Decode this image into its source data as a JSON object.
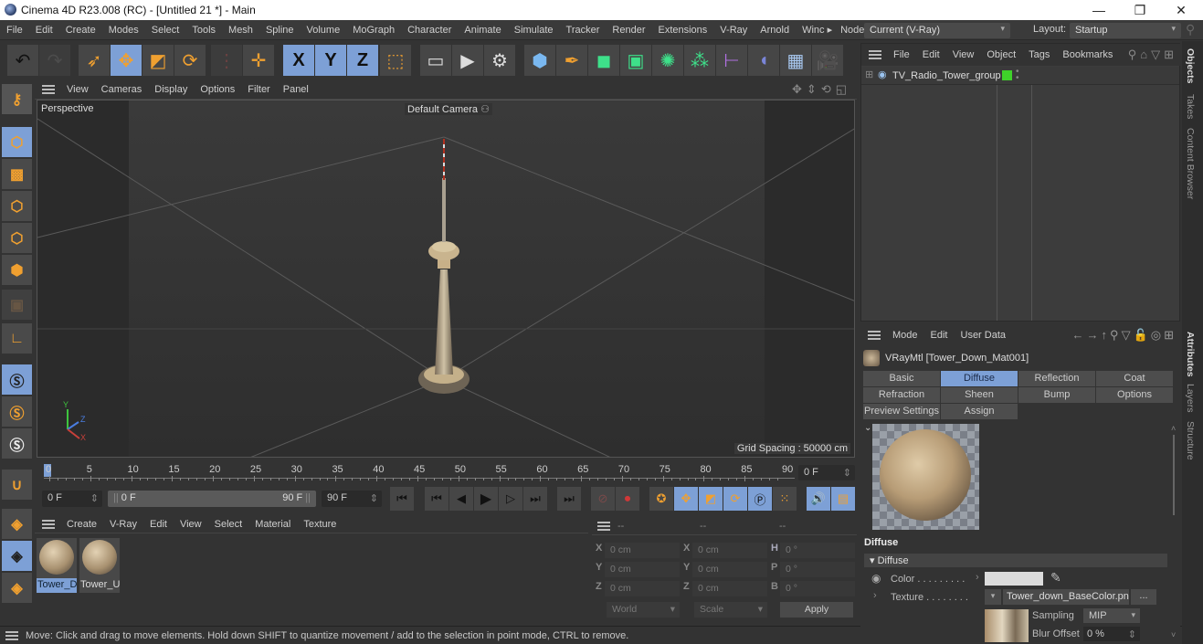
{
  "window": {
    "title": "Cinema 4D R23.008 (RC) - [Untitled 21 *] - Main",
    "minimize_glyph": "—",
    "maximize_glyph": "❐",
    "close_glyph": "✕"
  },
  "menubar": {
    "items": [
      "File",
      "Edit",
      "Create",
      "Modes",
      "Select",
      "Tools",
      "Mesh",
      "Spline",
      "Volume",
      "MoGraph",
      "Character",
      "Animate",
      "Simulate",
      "Tracker",
      "Render",
      "Extensions",
      "V-Ray",
      "Arnold",
      "Winc ▸"
    ],
    "node_space_label": "Node Space:",
    "node_space_value": "Current (V-Ray)",
    "layout_label": "Layout:",
    "layout_value": "Startup"
  },
  "toolbar": {
    "icons": [
      "undo-icon",
      "redo-icon",
      "live-selection-icon",
      "move-icon",
      "scale-icon",
      "rotate-icon",
      "recent-tools-icon",
      "add-tool-icon",
      "x-axis-lock-icon",
      "y-axis-lock-icon",
      "z-axis-lock-icon",
      "coordinate-system-icon",
      "render-view-icon",
      "render-to-picture-viewer-icon",
      "render-settings-icon",
      "cube-icon",
      "pen-icon",
      "subdivision-icon",
      "extrude-icon",
      "cloner-icon",
      "array-icon",
      "deformer-icon",
      "field-icon",
      "floor-icon",
      "camera-icon"
    ],
    "x_label": "X",
    "y_label": "Y",
    "z_label": "Z"
  },
  "viewport": {
    "menu": [
      "View",
      "Cameras",
      "Display",
      "Options",
      "Filter",
      "Panel"
    ],
    "view_name": "Perspective",
    "camera_name": "Default Camera",
    "grid_spacing": "Grid Spacing : 50000 cm",
    "axis_labels": {
      "x": "X",
      "y": "Y",
      "z": "Z"
    }
  },
  "timeline": {
    "ticks": [
      "0",
      "5",
      "10",
      "15",
      "20",
      "25",
      "30",
      "35",
      "40",
      "45",
      "50",
      "55",
      "60",
      "65",
      "70",
      "75",
      "80",
      "85",
      "90"
    ],
    "current_frame": "0 F",
    "start_frame": "0 F",
    "range_start": "0 F",
    "range_end": "90 F",
    "end_frame": "90 F"
  },
  "material_manager": {
    "menu": [
      "Create",
      "V-Ray",
      "Edit",
      "View",
      "Select",
      "Material",
      "Texture"
    ],
    "materials": [
      {
        "name": "Tower_D",
        "selected": true
      },
      {
        "name": "Tower_U",
        "selected": false
      }
    ]
  },
  "coordinates": {
    "headers": [
      "--",
      "--",
      "--"
    ],
    "rows": [
      {
        "l1": "X",
        "v1": "0 cm",
        "l2": "X",
        "v2": "0 cm",
        "l3": "H",
        "v3": "0 °"
      },
      {
        "l1": "Y",
        "v1": "0 cm",
        "l2": "Y",
        "v2": "0 cm",
        "l3": "P",
        "v3": "0 °"
      },
      {
        "l1": "Z",
        "v1": "0 cm",
        "l2": "Z",
        "v2": "0 cm",
        "l3": "B",
        "v3": "0 °"
      }
    ],
    "space": "World",
    "mode": "Scale",
    "apply_label": "Apply"
  },
  "status": {
    "text": "Move: Click and drag to move elements. Hold down SHIFT to quantize movement / add to the selection in point mode, CTRL to remove."
  },
  "objects_panel": {
    "menu": [
      "File",
      "Edit",
      "View",
      "Object",
      "Tags",
      "Bookmarks"
    ],
    "objects": [
      {
        "name": "TV_Radio_Tower_group",
        "color": "#3fd22a"
      }
    ]
  },
  "attributes_panel": {
    "menu": [
      "Mode",
      "Edit",
      "User Data"
    ],
    "material_title": "VRayMtl [Tower_Down_Mat001]",
    "tabs_row1": [
      "Basic",
      "Diffuse",
      "Reflection",
      "Coat"
    ],
    "tabs_row2": [
      "Refraction",
      "Sheen",
      "Bump",
      "Options"
    ],
    "tabs_row3": [
      "Preview Settings",
      "Assign"
    ],
    "active_tab": "Diffuse",
    "section_title": "Diffuse",
    "group_title": "▾ Diffuse",
    "color_label": "Color . . . . . . . . .",
    "color_value": "#dcdcdc",
    "texture_label": "Texture . . . . . . . .",
    "texture_file": "Tower_down_BaseColor.png",
    "texture_more": "...",
    "sampling_label": "Sampling",
    "sampling_value": "MIP",
    "blur_label": "Blur Offset",
    "blur_value": "0 %"
  },
  "side_tabs": {
    "top": [
      "Objects",
      "Takes",
      "Content Browser"
    ],
    "bottom": [
      "Attributes",
      "Layers",
      "Structure"
    ]
  },
  "colors": {
    "accent": "#7da0d6",
    "orange": "#f0a030",
    "panel": "#333333"
  }
}
